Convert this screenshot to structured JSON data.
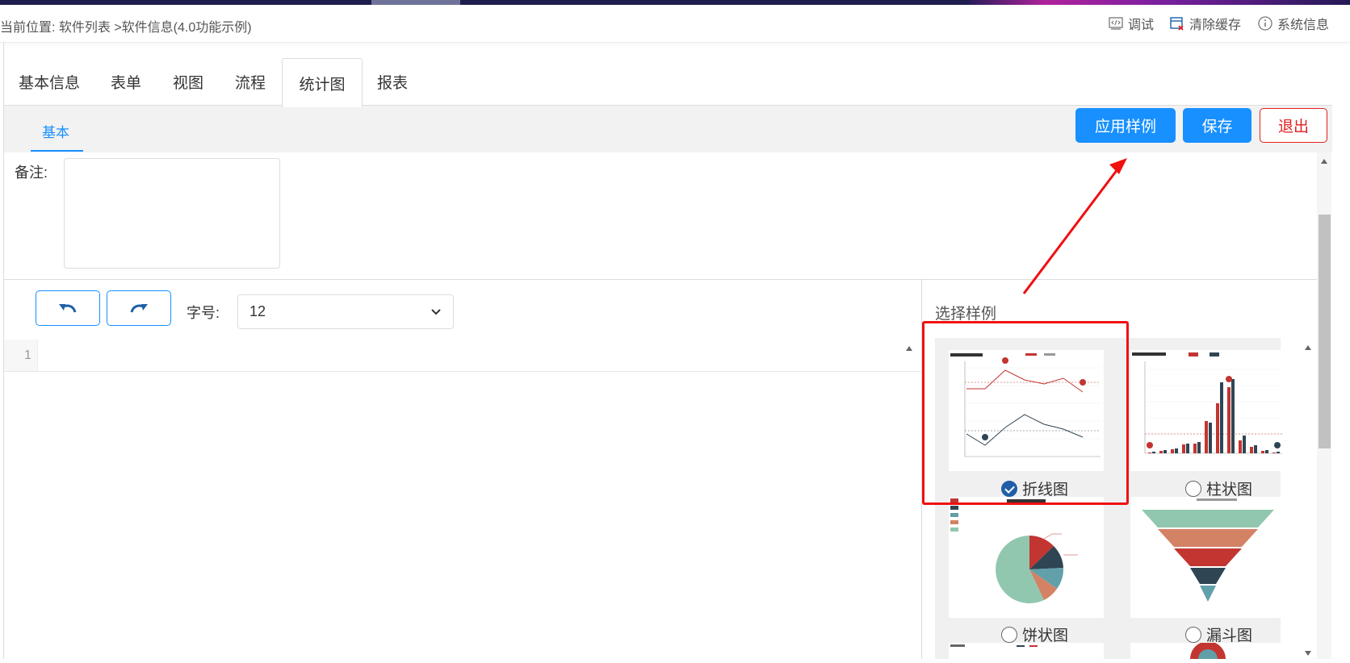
{
  "header": {
    "breadcrumb": "当前位置: 软件列表 >软件信息(4.0功能示例)",
    "debug_label": "调试",
    "clear_cache_label": "清除缓存",
    "system_info_label": "系统信息"
  },
  "tabs": [
    {
      "label": "基本信息"
    },
    {
      "label": "表单"
    },
    {
      "label": "视图"
    },
    {
      "label": "流程"
    },
    {
      "label": "统计图",
      "active": true
    },
    {
      "label": "报表"
    }
  ],
  "subtabs": {
    "basic": "基本"
  },
  "toolbar": {
    "apply_sample_label": "应用样例",
    "save_label": "保存",
    "exit_label": "退出"
  },
  "form": {
    "remark_label": "备注:",
    "remark_value": ""
  },
  "editor": {
    "font_size_label": "字号:",
    "font_size_value": "12",
    "line_number": "1"
  },
  "samples": {
    "title": "选择样例",
    "items": [
      {
        "label": "折线图",
        "selected": true
      },
      {
        "label": "柱状图",
        "selected": false
      },
      {
        "label": "饼状图",
        "selected": false
      },
      {
        "label": "漏斗图",
        "selected": false
      }
    ]
  },
  "colors": {
    "primary": "#1890ff",
    "danger": "#e02020",
    "highlight": "#f01010",
    "chart_red": "#c23531",
    "chart_dark": "#2f4554",
    "chart_teal": "#61a0a8",
    "chart_orange": "#d48265",
    "chart_green": "#91c7ae"
  }
}
